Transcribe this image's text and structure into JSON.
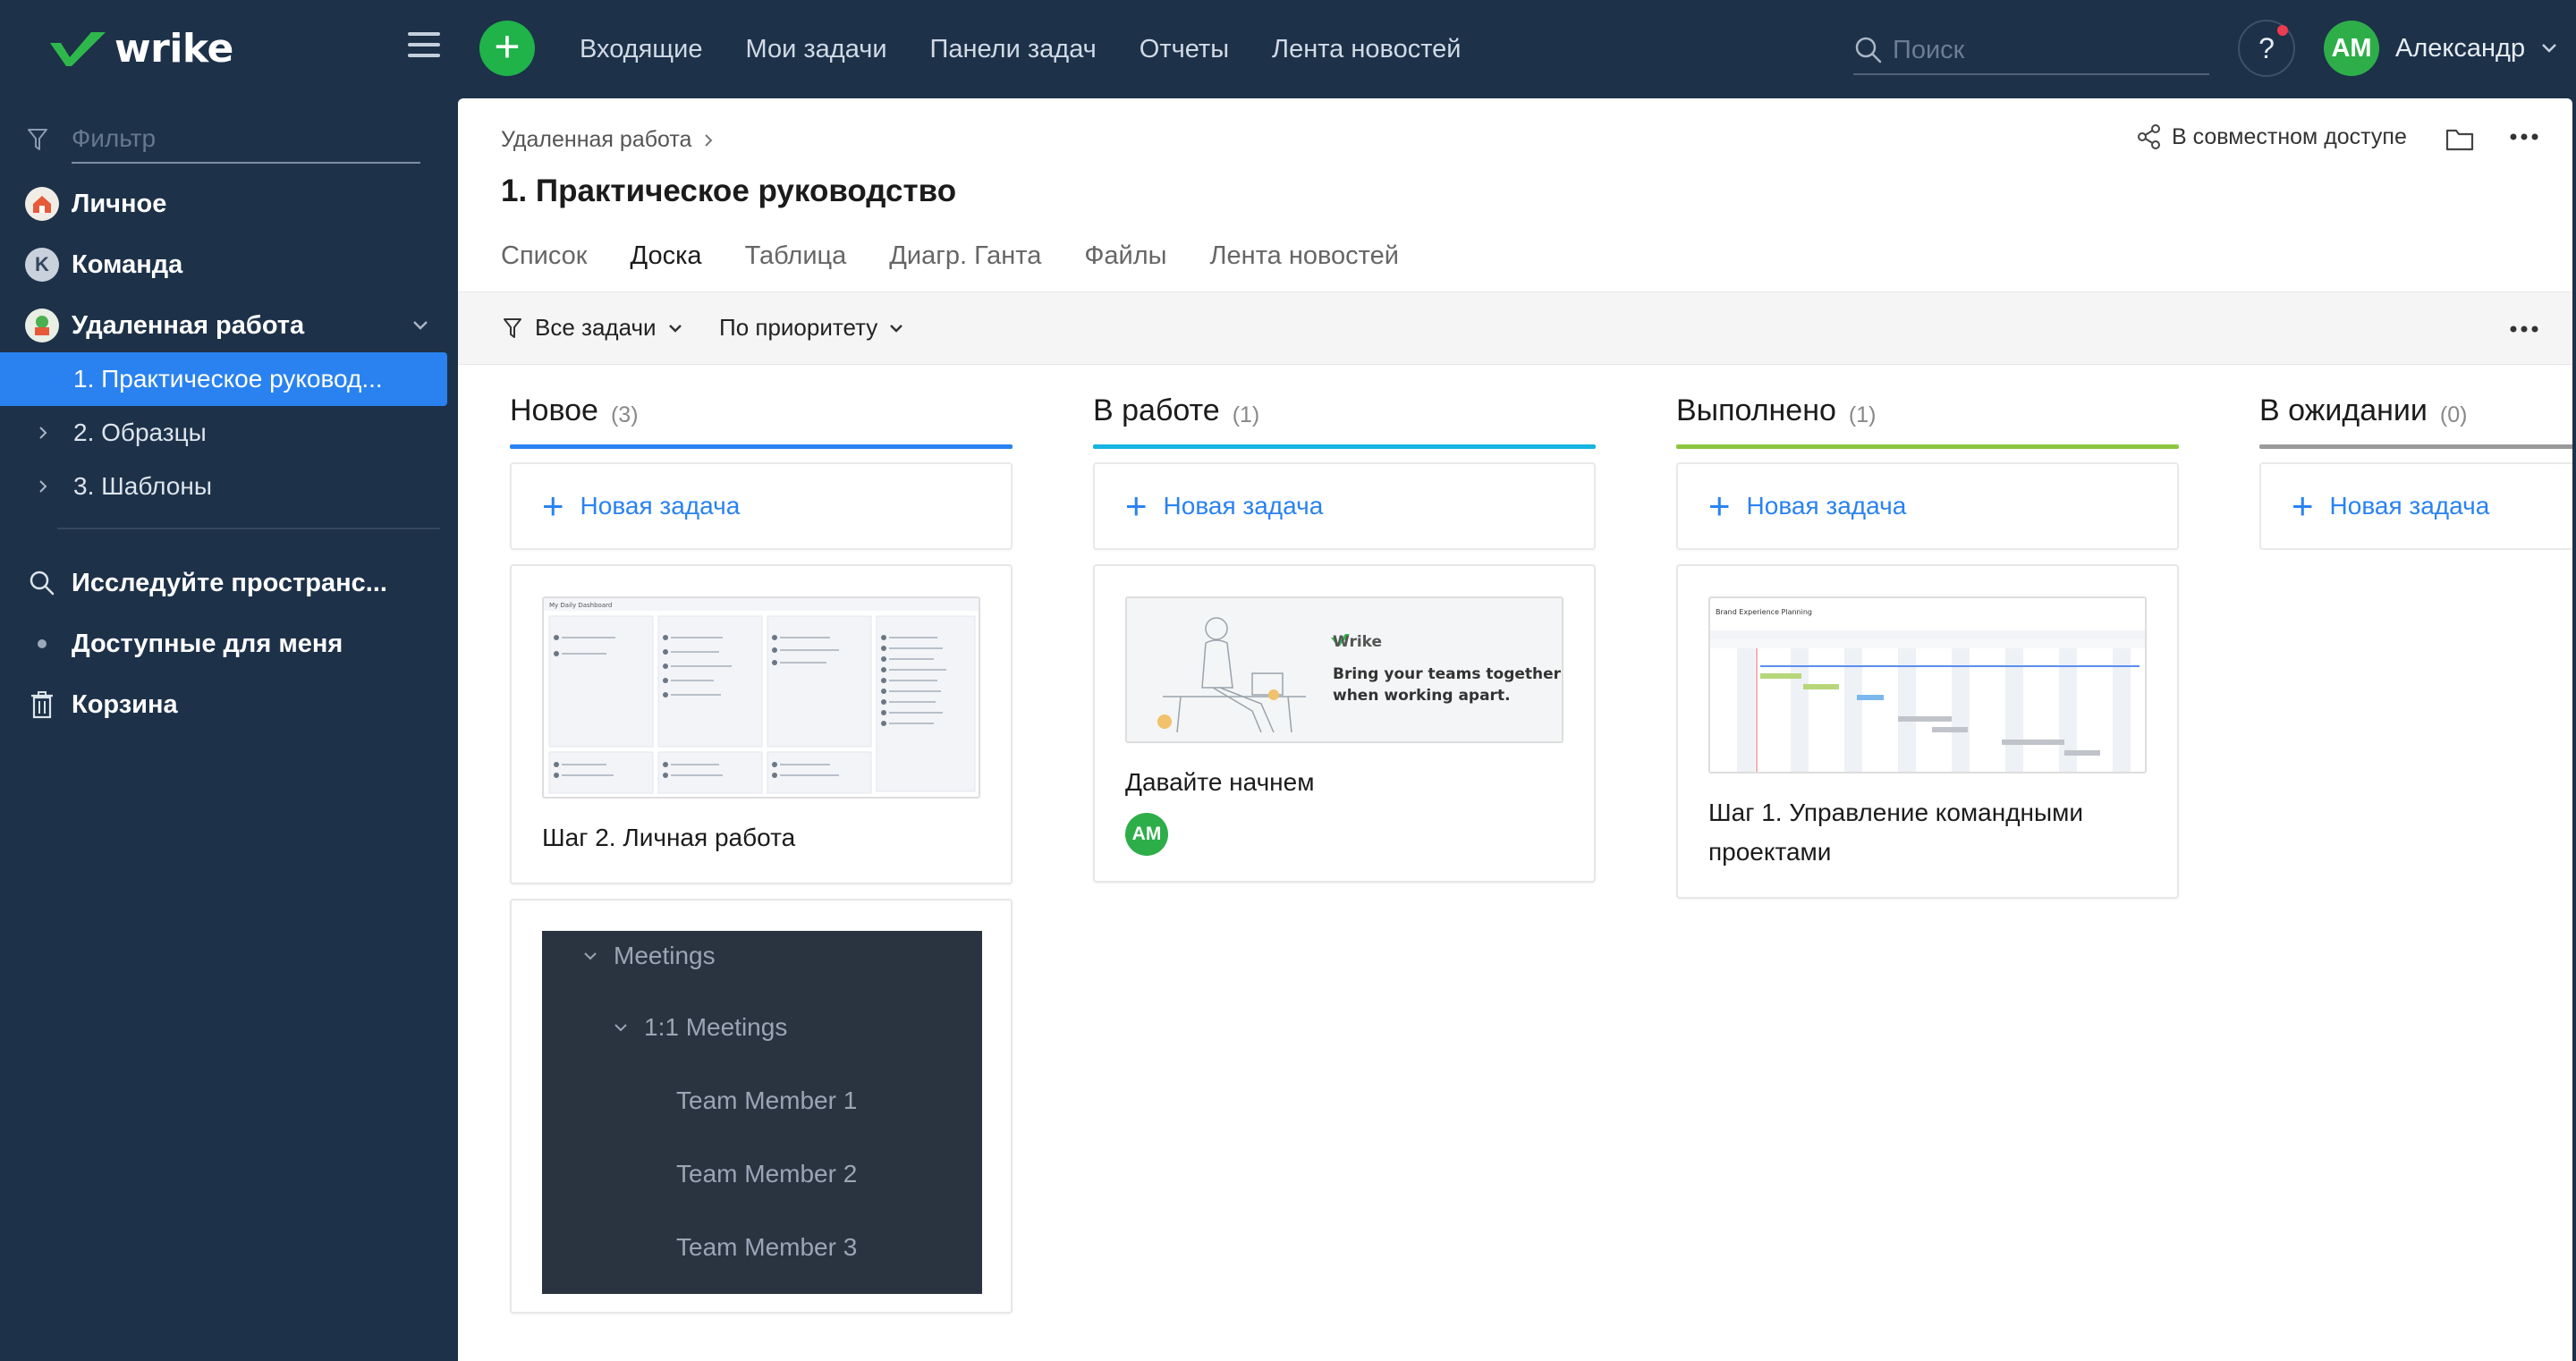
{
  "app": {
    "logo_text": "wrike"
  },
  "topbar": {
    "nav": [
      "Входящие",
      "Мои задачи",
      "Панели задач",
      "Отчеты",
      "Лента новостей"
    ],
    "search_placeholder": "Поиск",
    "help_label": "?",
    "user_initials": "АМ",
    "user_name": "Александр"
  },
  "sidebar": {
    "filter_placeholder": "Фильтр",
    "items": [
      {
        "label": "Личное",
        "icon": "house-icon"
      },
      {
        "label": "Команда",
        "icon": "team-letter-icon",
        "letter": "K"
      },
      {
        "label": "Удаленная работа",
        "icon": "remote-work-icon"
      }
    ],
    "subitems": [
      {
        "label": "1. Практическое руковод...",
        "active": true
      },
      {
        "label": "2. Образцы"
      },
      {
        "label": "3. Шаблоны"
      }
    ],
    "bottom_items": [
      {
        "label": "Исследуйте пространс...",
        "icon": "search-icon"
      },
      {
        "label": "Доступные для меня",
        "icon": "dot-icon"
      },
      {
        "label": "Корзина",
        "icon": "trash-icon"
      }
    ]
  },
  "main": {
    "breadcrumb": "Удаленная работа",
    "title": "1. Практическое руководство",
    "share_label": "В совместном доступе",
    "tabs": [
      "Список",
      "Доска",
      "Таблица",
      "Диагр. Ганта",
      "Файлы",
      "Лента новостей"
    ],
    "active_tab": "Доска",
    "toolbar": {
      "filter_label": "Все задачи",
      "sort_label": "По приоритету"
    }
  },
  "board": {
    "new_task_label": "Новая задача",
    "columns": [
      {
        "title": "Новое",
        "count": "(3)",
        "color": "#2a82f0"
      },
      {
        "title": "В работе",
        "count": "(1)",
        "color": "#16b4e0"
      },
      {
        "title": "Выполнено",
        "count": "(1)",
        "color": "#8cc63f"
      },
      {
        "title": "В ожидании",
        "count": "(0)",
        "color": "#9a9a9a"
      }
    ],
    "cards": {
      "new_1": {
        "title": "Шаг 2. Личная работа",
        "thumb_title": "My Daily Dashboard"
      },
      "new_2": {
        "rows": [
          "Meetings",
          "1:1 Meetings",
          "Team Member 1",
          "Team Member 2",
          "Team Member 3"
        ]
      },
      "in_progress_1": {
        "title": "Давайте начнем",
        "assignee": "АМ",
        "banner_brand": "Wrike",
        "banner_text_1": "Bring your teams together",
        "banner_text_2": "when working apart."
      },
      "done_1": {
        "title": "Шаг 1. Управление командными проектами",
        "thumb_title": "Brand Experience Planning"
      }
    }
  }
}
